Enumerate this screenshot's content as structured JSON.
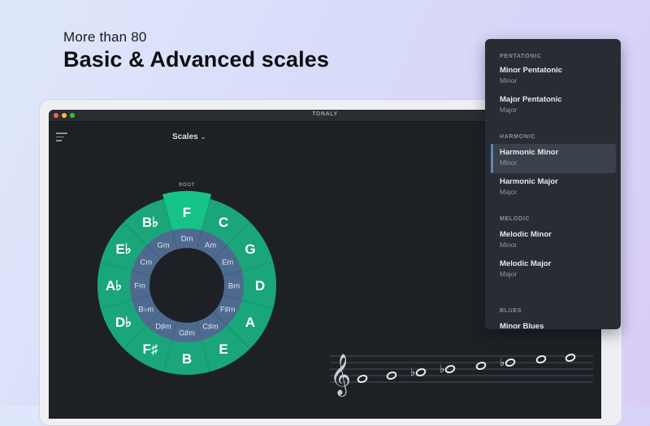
{
  "hero": {
    "subtitle": "More than 80",
    "title": "Basic & Advanced scales"
  },
  "window": {
    "title": "TONALY",
    "scales_label": "Scales",
    "root_label": "ROOT"
  },
  "colors": {
    "wheel_outer": "#1aa57a",
    "wheel_selected": "#15c288",
    "wheel_inner": "#4f6a8f",
    "wheel_center": "#1d2126",
    "dropdown_bg": "#282d34",
    "selected_bar": "#5f86b5"
  },
  "icons": {
    "menu": "hamburger-icon",
    "scales_chevron": "chevron-down-icon",
    "clef": "treble-clef-icon"
  },
  "wheel": {
    "outer": [
      "F",
      "C",
      "G",
      "D",
      "A",
      "E",
      "B",
      "F♯",
      "D♭",
      "A♭",
      "E♭",
      "B♭"
    ],
    "inner": [
      "Dm",
      "Am",
      "Em",
      "Bm",
      "F♯m",
      "C♯m",
      "G♯m",
      "D♯m",
      "B♭m",
      "Fm",
      "Cm",
      "Gm"
    ],
    "selected": "F"
  },
  "dropdown": {
    "sections": [
      {
        "title": "PENTATONIC",
        "items": [
          {
            "name": "Minor Pentatonic",
            "type": "Minor"
          },
          {
            "name": "Major Pentatonic",
            "type": "Major"
          }
        ]
      },
      {
        "title": "HARMONIC",
        "items": [
          {
            "name": "Harmonic Minor",
            "type": "Minor",
            "selected": true
          },
          {
            "name": "Harmonic Major",
            "type": "Major"
          }
        ]
      },
      {
        "title": "MELODIC",
        "items": [
          {
            "name": "Melodic Minor",
            "type": "Minor"
          },
          {
            "name": "Melodic Major",
            "type": "Major"
          }
        ]
      },
      {
        "title": "BLUES",
        "items": [
          {
            "name": "Minor Blues",
            "type": ""
          }
        ]
      }
    ]
  },
  "staff": {
    "notes": [
      {
        "accidental": ""
      },
      {
        "accidental": ""
      },
      {
        "accidental": "♭"
      },
      {
        "accidental": "♭"
      },
      {
        "accidental": ""
      },
      {
        "accidental": "♭"
      },
      {
        "accidental": ""
      },
      {
        "accidental": ""
      }
    ]
  }
}
